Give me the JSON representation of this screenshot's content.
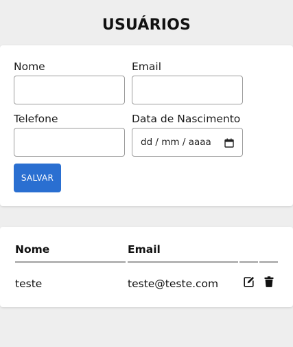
{
  "header": {
    "title": "USUÁRIOS"
  },
  "form": {
    "name_label": "Nome",
    "name_value": "",
    "email_label": "Email",
    "email_value": "",
    "phone_label": "Telefone",
    "phone_value": "",
    "birth_label": "Data de Nascimento",
    "birth_placeholder": "dd / mm / aaaa",
    "save_label": "SALVAR"
  },
  "table": {
    "columns": [
      "Nome",
      "Email",
      "",
      ""
    ],
    "rows": [
      {
        "name": "teste",
        "email": "teste@teste.com",
        "actions": [
          "edit-icon",
          "trash-icon"
        ]
      }
    ]
  },
  "colors": {
    "primary": "#2a6fd1",
    "background": "#eeeeee",
    "card": "#ffffff"
  }
}
